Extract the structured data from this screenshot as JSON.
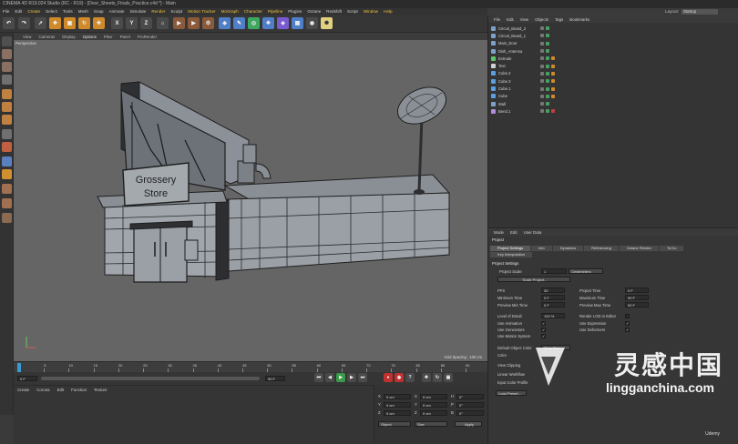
{
  "window": {
    "title": "CINEMA 4D R19.024 Studio (RC - R19) - [Door_Sheets_Finals_Practice.c4d *] - Main"
  },
  "menubar": {
    "items": [
      "File",
      "Edit",
      "Create",
      "Select",
      "Tools",
      "Mesh",
      "Snap",
      "Animate",
      "Simulate",
      "Render",
      "Sculpt",
      "Motion Tracker",
      "MoGraph",
      "Character",
      "Pipeline",
      "Plugins",
      "Octane",
      "Redshift",
      "Script",
      "Window",
      "Help"
    ],
    "highlighted": [
      "Create",
      "Render",
      "Motion Tracker",
      "MoGraph",
      "Character",
      "Pipeline",
      "Window",
      "Help"
    ],
    "layout_label": "Layout:",
    "layout_value": "Startup"
  },
  "toolbar": {
    "axis_x": "X",
    "axis_y": "Y",
    "axis_z": "Z"
  },
  "viewport": {
    "menu": [
      "View",
      "Cameras",
      "Display",
      "Options",
      "Filter",
      "Panel",
      "ProRender"
    ],
    "active_menu": "Options",
    "label": "Perspective",
    "grid_spacing": "Grid Spacing : 100 cm",
    "sign_line1": "Grossery",
    "sign_line2": "Store"
  },
  "timeline": {
    "ticks": [
      "0",
      "5",
      "10",
      "15",
      "20",
      "25",
      "30",
      "35",
      "40",
      "45",
      "50",
      "55",
      "60",
      "65",
      "70",
      "75",
      "80",
      "85",
      "90"
    ],
    "start_frame": "0 F",
    "end_frame": "90 F",
    "current": "0 F"
  },
  "material_menu": [
    "Create",
    "Corona",
    "Edit",
    "Function",
    "Texture"
  ],
  "coord": {
    "rows": [
      {
        "axis": "X",
        "pos": "0 cm",
        "axis2": "X",
        "size": "0 cm",
        "axis3": "H",
        "rot": "0°"
      },
      {
        "axis": "Y",
        "pos": "0 cm",
        "axis2": "Y",
        "size": "0 cm",
        "axis3": "P",
        "rot": "0°"
      },
      {
        "axis": "Z",
        "pos": "0 cm",
        "axis2": "Z",
        "size": "0 cm",
        "axis3": "B",
        "rot": "0°"
      }
    ],
    "mode1": "Object",
    "mode2": "Size",
    "apply": "Apply"
  },
  "object_manager": {
    "menu": [
      "File",
      "Edit",
      "View",
      "Objects",
      "Tags",
      "Bookmarks"
    ],
    "objects": [
      {
        "name": "Circuit_Board_2",
        "color": "#7fa0c8"
      },
      {
        "name": "Circuit_Board_1",
        "color": "#7fa0c8"
      },
      {
        "name": "Main_Door",
        "color": "#7fa0c8"
      },
      {
        "name": "Dish_Antenna",
        "color": "#7fa0c8"
      },
      {
        "name": "Extrude",
        "color": "#5ec46a"
      },
      {
        "name": "Text",
        "color": "#d0d0d0"
      },
      {
        "name": "Cube.2",
        "color": "#5aa0e0"
      },
      {
        "name": "Cube.3",
        "color": "#5aa0e0"
      },
      {
        "name": "Cube.1",
        "color": "#5aa0e0"
      },
      {
        "name": "Cube",
        "color": "#5aa0e0"
      },
      {
        "name": "Wall",
        "color": "#7fa0c8"
      },
      {
        "name": "Bend.1",
        "color": "#b08cd8"
      }
    ]
  },
  "attributes": {
    "menu": [
      "Mode",
      "Edit",
      "User Data"
    ],
    "title": "Project",
    "tabs": [
      "Project Settings",
      "Info",
      "Dynamics",
      "Referencing",
      "Octane Render",
      "To Do"
    ],
    "tab2": "Key Interpolation",
    "section": "Project Settings",
    "project_scale_label": "Project Scale",
    "project_scale_value": "1",
    "project_scale_unit": "Centimeters",
    "scale_button": "Scale Project...",
    "fields": [
      {
        "label": "FPS",
        "value": "30"
      },
      {
        "label": "Project Time",
        "value": "0 F"
      },
      {
        "label": "Minimum Time",
        "value": "0 F"
      },
      {
        "label": "Maximum Time",
        "value": "90 F"
      },
      {
        "label": "Preview Min Time",
        "value": "0 F"
      },
      {
        "label": "Preview Max Time",
        "value": "90 F"
      },
      {
        "label": "Level of Detail",
        "value": "100 %"
      },
      {
        "label": "Render LOD in Editor",
        "value": ""
      }
    ],
    "checks": [
      {
        "label": "Use Animation",
        "checked": "✓"
      },
      {
        "label": "Use Expression",
        "checked": "✓"
      },
      {
        "label": "Use Generators",
        "checked": "✓"
      },
      {
        "label": "Use Deformers",
        "checked": "✓"
      },
      {
        "label": "Use Motion System",
        "checked": "✓"
      }
    ],
    "default_color_label": "Default Object Color",
    "default_color_value": "Gray-Blue",
    "color_label": "Color",
    "view_clipping_label": "View Clipping",
    "linear_workflow_label": "Linear Workflow",
    "input_color_label": "Input Color Profile",
    "load_preset": "Load Preset..."
  },
  "watermark": {
    "big": "灵感中国",
    "url": "lingganchina.com",
    "udemy": "Udemy"
  }
}
